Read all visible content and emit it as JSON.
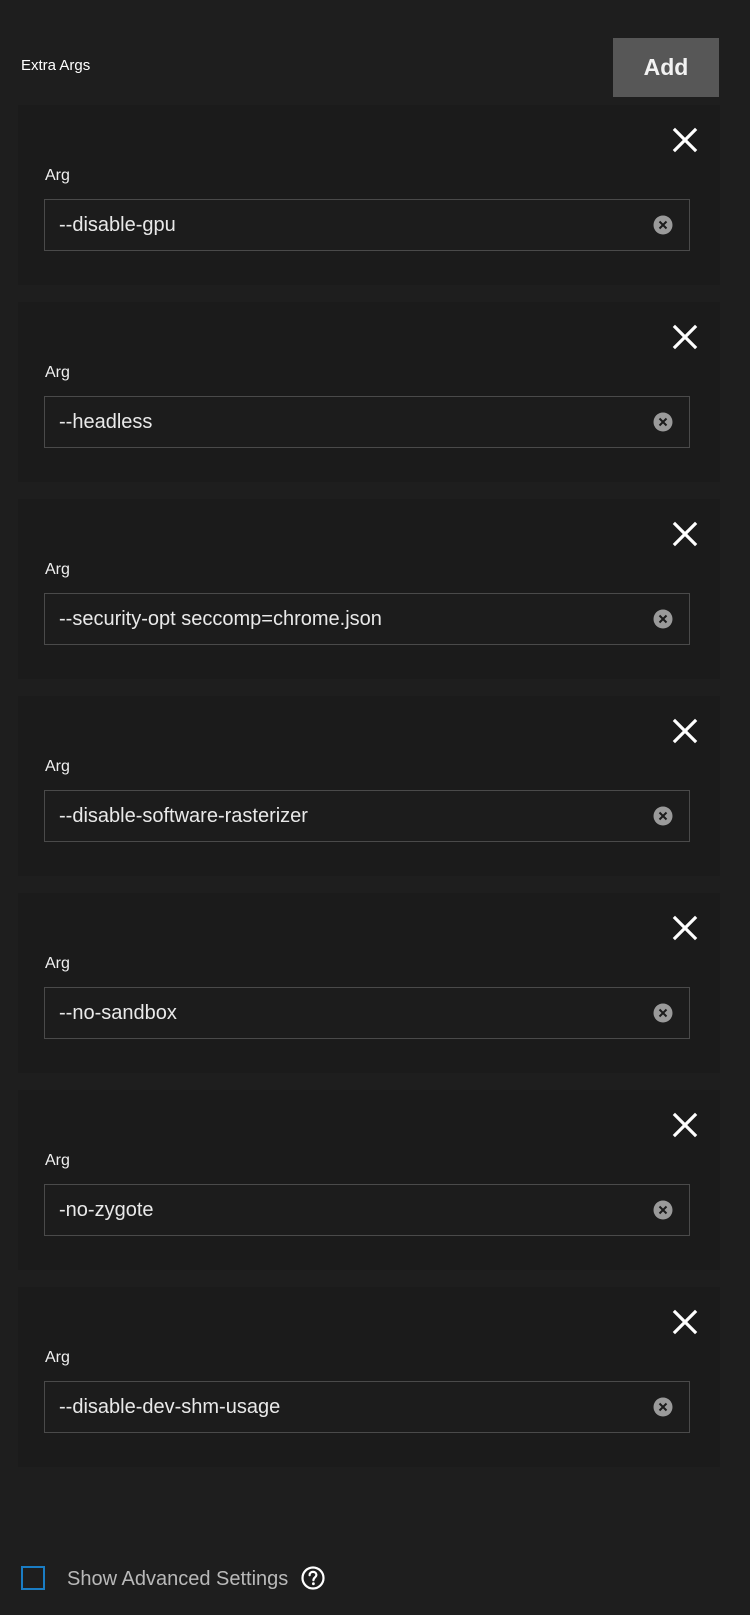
{
  "section": {
    "title": "Extra Args",
    "add_label": "Add"
  },
  "args": [
    {
      "label": "Arg",
      "value": "--disable-gpu"
    },
    {
      "label": "Arg",
      "value": "--headless"
    },
    {
      "label": "Arg",
      "value": "--security-opt seccomp=chrome.json"
    },
    {
      "label": "Arg",
      "value": "--disable-software-rasterizer"
    },
    {
      "label": "Arg",
      "value": "--no-sandbox"
    },
    {
      "label": "Arg",
      "value": "-no-zygote"
    },
    {
      "label": "Arg",
      "value": "--disable-dev-shm-usage"
    }
  ],
  "advanced": {
    "label": "Show Advanced Settings",
    "checked": false
  },
  "icons": {
    "remove": "close-icon",
    "clear": "clear-circle-icon",
    "help": "help-circle-icon"
  },
  "colors": {
    "background": "#1e1e1e",
    "card": "#1b1b1b",
    "button": "#575757",
    "accent": "#1a7dc4"
  }
}
